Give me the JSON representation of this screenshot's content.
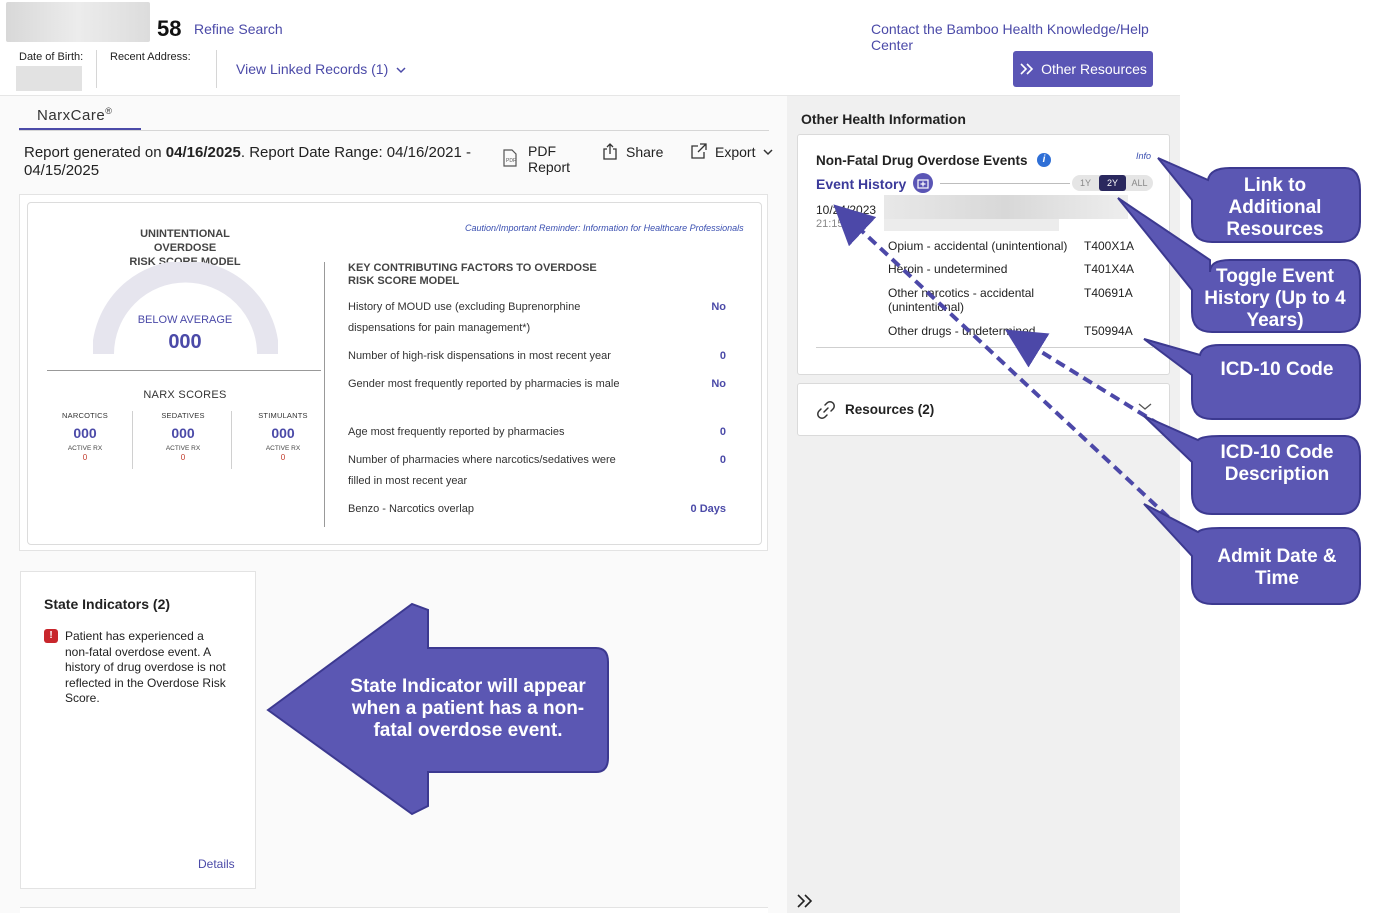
{
  "header": {
    "age": "58",
    "refine_search": "Refine Search",
    "help_link": "Contact the Bamboo Health Knowledge/Help Center",
    "dob_label": "Date of Birth:",
    "address_label": "Recent Address:",
    "linked_records": "View Linked Records (1)",
    "other_resources": "Other Resources"
  },
  "tabs": {
    "narxcare": "NarxCare",
    "narxcare_mark": "®"
  },
  "report": {
    "prefix": "Report generated on ",
    "date": "04/16/2025",
    "suffix": ". Report Date Range: 04/16/2021 - 04/15/2025",
    "pdf_line1": "PDF",
    "pdf_line2": "Report",
    "share": "Share",
    "export": "Export"
  },
  "score_card": {
    "model_title_line1": "UNINTENTIONAL OVERDOSE",
    "model_title_line2": "RISK SCORE MODEL",
    "caution": "Caution/Important Reminder: Information for Healthcare Professionals",
    "gauge_label": "BELOW AVERAGE",
    "gauge_score": "000",
    "narx_title": "NARX SCORES",
    "narx": [
      {
        "name": "NARCOTICS",
        "value": "000",
        "active_label": "ACTIVE RX",
        "active_value": "0"
      },
      {
        "name": "SEDATIVES",
        "value": "000",
        "active_label": "ACTIVE RX",
        "active_value": "0"
      },
      {
        "name": "STIMULANTS",
        "value": "000",
        "active_label": "ACTIVE RX",
        "active_value": "0"
      }
    ],
    "kf_title_line1": "KEY CONTRIBUTING FACTORS TO OVERDOSE",
    "kf_title_line2": "RISK SCORE MODEL",
    "factors": [
      {
        "label": "History of MOUD use (excluding Buprenorphine dispensations for pain management*)",
        "value": "No"
      },
      {
        "label": "Number of high-risk dispensations in most recent year",
        "value": "0"
      },
      {
        "label": "Gender most frequently reported by pharmacies is male",
        "value": "No"
      },
      {
        "label": "Age most frequently reported by pharmacies",
        "value": "0"
      },
      {
        "label": "Number of pharmacies where narcotics/sedatives were filled in most recent year",
        "value": "0"
      },
      {
        "label": "Benzo - Narcotics overlap",
        "value": "0 Days"
      }
    ]
  },
  "state_indicators": {
    "title": "State Indicators (2)",
    "alert_icon": "!",
    "message": "Patient has experienced a non-fatal overdose event. A history of drug overdose is not reflected in the Overdose Risk Score.",
    "details": "Details"
  },
  "other_health": {
    "title": "Other Health Information",
    "nf_title": "Non-Fatal Drug Overdose Events",
    "info_glyph": "i",
    "info_link": "Info",
    "event_history": "Event History",
    "toggle": [
      "1Y",
      "2Y",
      "ALL"
    ],
    "toggle_active": "2Y",
    "event_date": "10/24/2023",
    "event_time": "21:15",
    "icd": [
      {
        "description": "Opium - accidental (unintentional)",
        "code": "T400X1A"
      },
      {
        "description": "Heroin - undetermined",
        "code": "T401X4A"
      },
      {
        "description": "Other narcotics - accidental (unintentional)",
        "code": "T40691A"
      },
      {
        "description": "Other drugs - undetermined",
        "code": "T50994A"
      }
    ],
    "resources": "Resources (2)"
  },
  "annotations": {
    "link_resources": "Link to Additional Resources",
    "toggle_history": "Toggle Event History (Up to 4 Years)",
    "icd_code": "ICD-10 Code",
    "icd_desc": "ICD-10 Code Description",
    "admit": "Admit Date & Time",
    "state_indicator": "State Indicator will appear when a patient has a non-fatal overdose event."
  },
  "colors": {
    "accent": "#5a55b5",
    "link": "#4b4aa8",
    "alert": "#c8262c",
    "callout": "#5b57b3"
  }
}
